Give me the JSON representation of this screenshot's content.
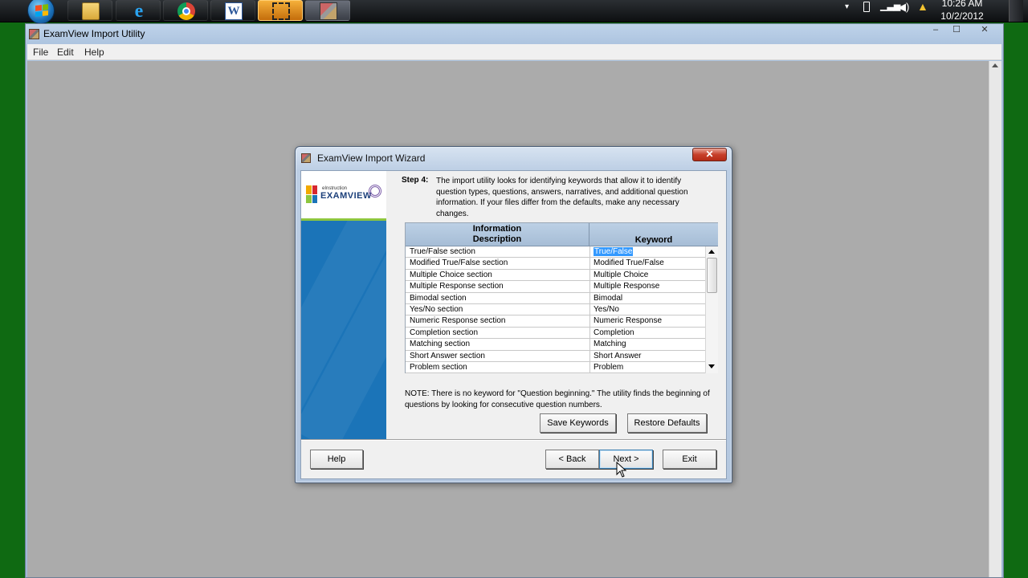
{
  "taskbar": {
    "clock_time": "10:26 AM",
    "clock_date": "10/2/2012",
    "pinned": [
      {
        "name": "windows-explorer-icon"
      },
      {
        "name": "internet-explorer-icon"
      },
      {
        "name": "chrome-icon"
      },
      {
        "name": "word-icon",
        "letter": "W"
      },
      {
        "name": "snipping-tool-icon"
      },
      {
        "name": "examview-taskbar-icon"
      }
    ],
    "tray_icons": [
      "chevron-up-icon",
      "battery-icon",
      "network-icon",
      "volume-icon",
      "drive-icon"
    ]
  },
  "main_window": {
    "title": "ExamView Import Utility",
    "caption": {
      "minimize": "‒",
      "maximize": "☐",
      "close": "✕"
    },
    "menu": [
      "File",
      "Edit",
      "Help"
    ]
  },
  "wizard": {
    "title": "ExamView Import Wizard",
    "close_glyph": "✕",
    "logo_sub": "eInstruction",
    "logo_main": "EXAMVIEW",
    "step_label": "Step 4:",
    "step_text": "The import utility looks for identifying keywords that allow it to identify question types, questions, answers, narratives, and additional question information.  If your files differ from the defaults, make any necessary changes.",
    "grid": {
      "header_info_line1": "Information",
      "header_info_line2": "Description",
      "header_keyword": "Keyword",
      "rows": [
        {
          "description": "True/False section",
          "keyword": "True/False"
        },
        {
          "description": "Modified True/False section",
          "keyword": "Modified True/False"
        },
        {
          "description": "Multiple Choice section",
          "keyword": "Multiple Choice"
        },
        {
          "description": "Multiple Response section",
          "keyword": "Multiple Response"
        },
        {
          "description": "Bimodal section",
          "keyword": "Bimodal"
        },
        {
          "description": "Yes/No section",
          "keyword": "Yes/No"
        },
        {
          "description": "Numeric Response section",
          "keyword": "Numeric Response"
        },
        {
          "description": "Completion section",
          "keyword": "Completion"
        },
        {
          "description": "Matching section",
          "keyword": "Matching"
        },
        {
          "description": "Short Answer section",
          "keyword": "Short Answer"
        },
        {
          "description": "Problem section",
          "keyword": "Problem"
        }
      ]
    },
    "note": "NOTE: There is no keyword for \"Question beginning.\"  The utility finds the beginning of questions by looking for consecutive question numbers.",
    "buttons": {
      "save_keywords": "Save Keywords",
      "restore_defaults": "Restore Defaults",
      "help": "Help",
      "back": "< Back",
      "next": "Next >",
      "exit": "Exit"
    }
  },
  "colors": {
    "desktop": "#0f6a12",
    "side_panel": "#1b74b8",
    "selection": "#3399ff",
    "close_button": "#c7402b"
  }
}
